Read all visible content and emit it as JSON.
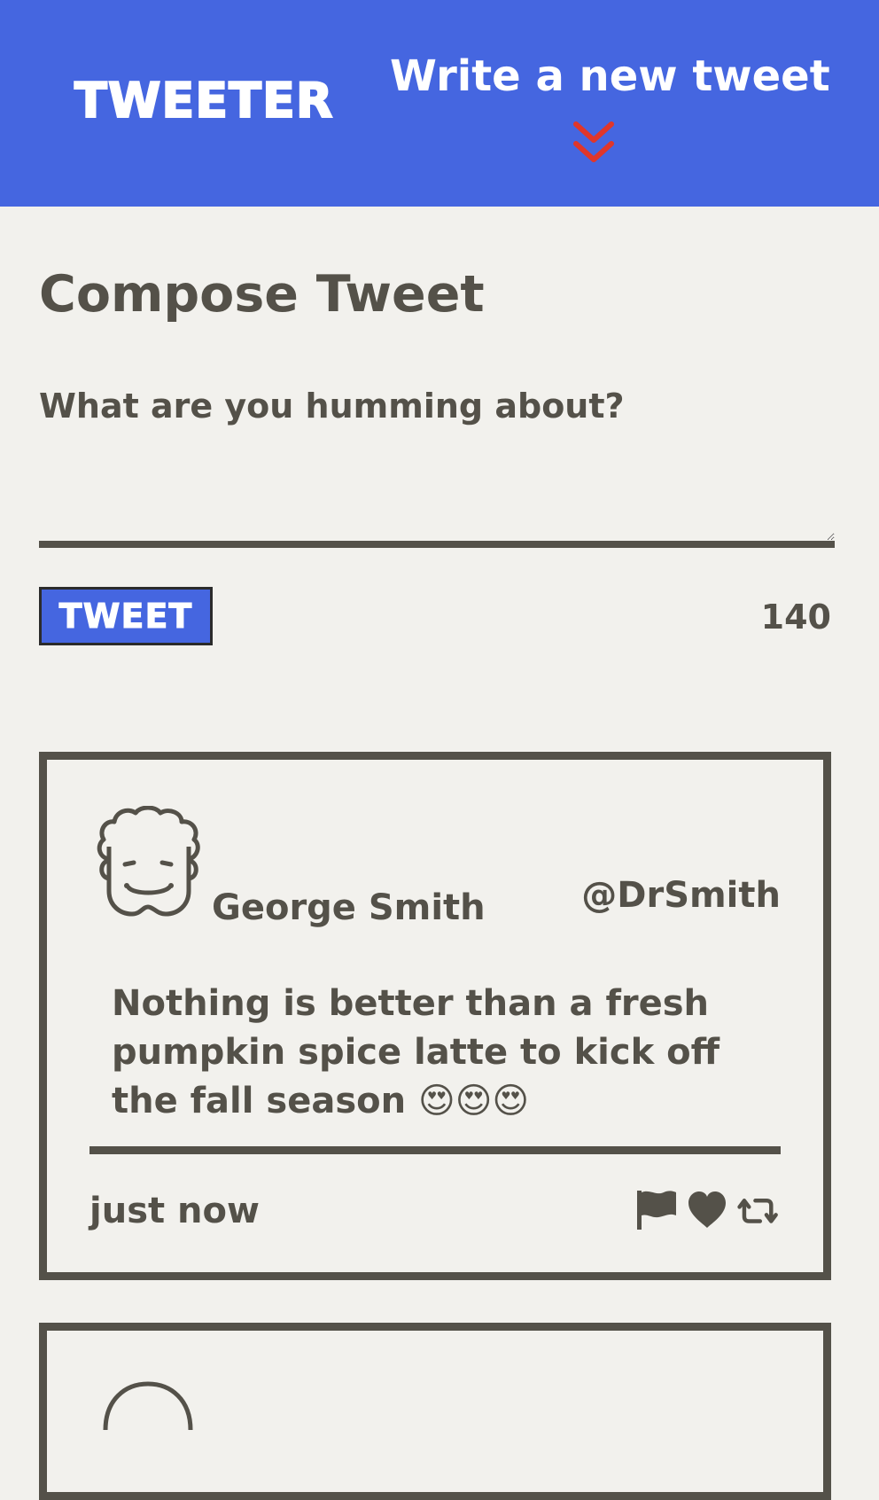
{
  "nav": {
    "brand": "TWEETER",
    "write_new_label": "Write a new tweet"
  },
  "compose": {
    "title": "Compose Tweet",
    "label": "What are you humming about?",
    "textarea_value": "",
    "tweet_button_label": "TWEET",
    "char_counter": "140"
  },
  "tweets": [
    {
      "name": "George Smith",
      "handle": "@DrSmith",
      "text": "Nothing is better than a fresh pumpkin spice latte to kick off the fall season 😍😍😍",
      "timestamp": "just now",
      "actions": [
        "flag-icon",
        "heart-icon",
        "retweet-icon"
      ],
      "avatar": "avatar-icon"
    }
  ],
  "colors": {
    "header_bg": "#4566e0",
    "page_bg": "#f2f1ed",
    "text": "#545149",
    "accent_chevron": "#e0362a",
    "button_bg": "#4566e0"
  },
  "icons": {
    "write_new": "double-chevron-down-icon"
  }
}
